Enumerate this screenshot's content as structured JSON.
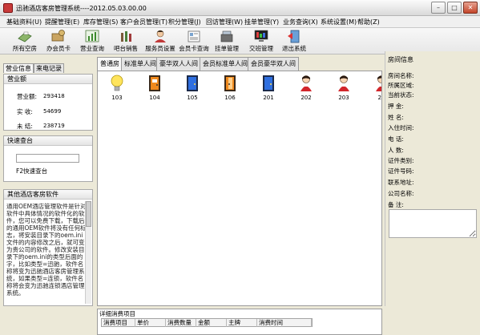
{
  "window": {
    "title": "迅驰酒店客房管理系统----2012.05.03.00.00",
    "minimize": "–",
    "maximize": "□",
    "close": "✕"
  },
  "menu": [
    "基础资料(U)",
    "提醒管理(E)",
    "库存管理(S)",
    "客户会员管理(T)",
    "积分管理(J)",
    "回访管理(W)",
    "挂单管理(Y)",
    "业务查询(X)",
    "系统设置(M)",
    "帮助(Z)"
  ],
  "toolbar": [
    "所有空房",
    "办会员卡",
    "营业查询",
    "吧台销售",
    "服务员设置",
    "会员卡查询",
    "挂单管理",
    "交班管理",
    "退出系统"
  ],
  "left": {
    "tabs": [
      "营业信息",
      "来电记录"
    ],
    "revenue": {
      "header": "营业额",
      "rows": [
        {
          "label": "营业额:",
          "value": "293418"
        },
        {
          "label": "实  收:",
          "value": "54699"
        },
        {
          "label": "未  结:",
          "value": "238719"
        }
      ]
    },
    "quick": {
      "header": "快速查台",
      "hint": "F2快速查台"
    },
    "other": {
      "header": "其他酒店客房软件",
      "text": "通用OEM酒店管理软件是针对软件中具体情况的软件化的软件，您可以免费下载，下载后的通用OEM软件将没有任何标志，将安装目录下的oem.ini文件的内容修改之后，就可变为贵公司的软件。修改安装目录下的oem.ini的类型后面的字，比如类型=迅驰，软件名称将变为迅驰酒店客房管理系统，如果类型=连锁，软件名称将会变为迅驰连锁酒店管理系统。"
    }
  },
  "room_tabs": [
    "普通房",
    "标准单人间",
    "豪华双人人间",
    "会员标准单人间",
    "会员豪华双人间"
  ],
  "rooms": [
    {
      "number": "103",
      "type": "bulb"
    },
    {
      "number": "104",
      "type": "door-orange"
    },
    {
      "number": "105",
      "type": "door-blue"
    },
    {
      "number": "106",
      "type": "door-orange-open"
    },
    {
      "number": "201",
      "type": "door-blue"
    },
    {
      "number": "202",
      "type": "person"
    },
    {
      "number": "203",
      "type": "person"
    },
    {
      "number": "20",
      "type": "person"
    }
  ],
  "detail": {
    "title": "详细消费项目",
    "columns": [
      "消费项目",
      "单价",
      "消费数量",
      "金额",
      "主牌",
      "消费时间"
    ]
  },
  "right": {
    "title": "房间信息",
    "fields": [
      "房间名称:",
      "所属区域:",
      "当前状态:",
      "押    金:",
      "姓    名:",
      "入住时间:",
      "电    话:",
      "人    数:",
      "证件类别:",
      "证件号码:",
      "联系地址:",
      "公司名称:",
      "备    注:"
    ]
  }
}
